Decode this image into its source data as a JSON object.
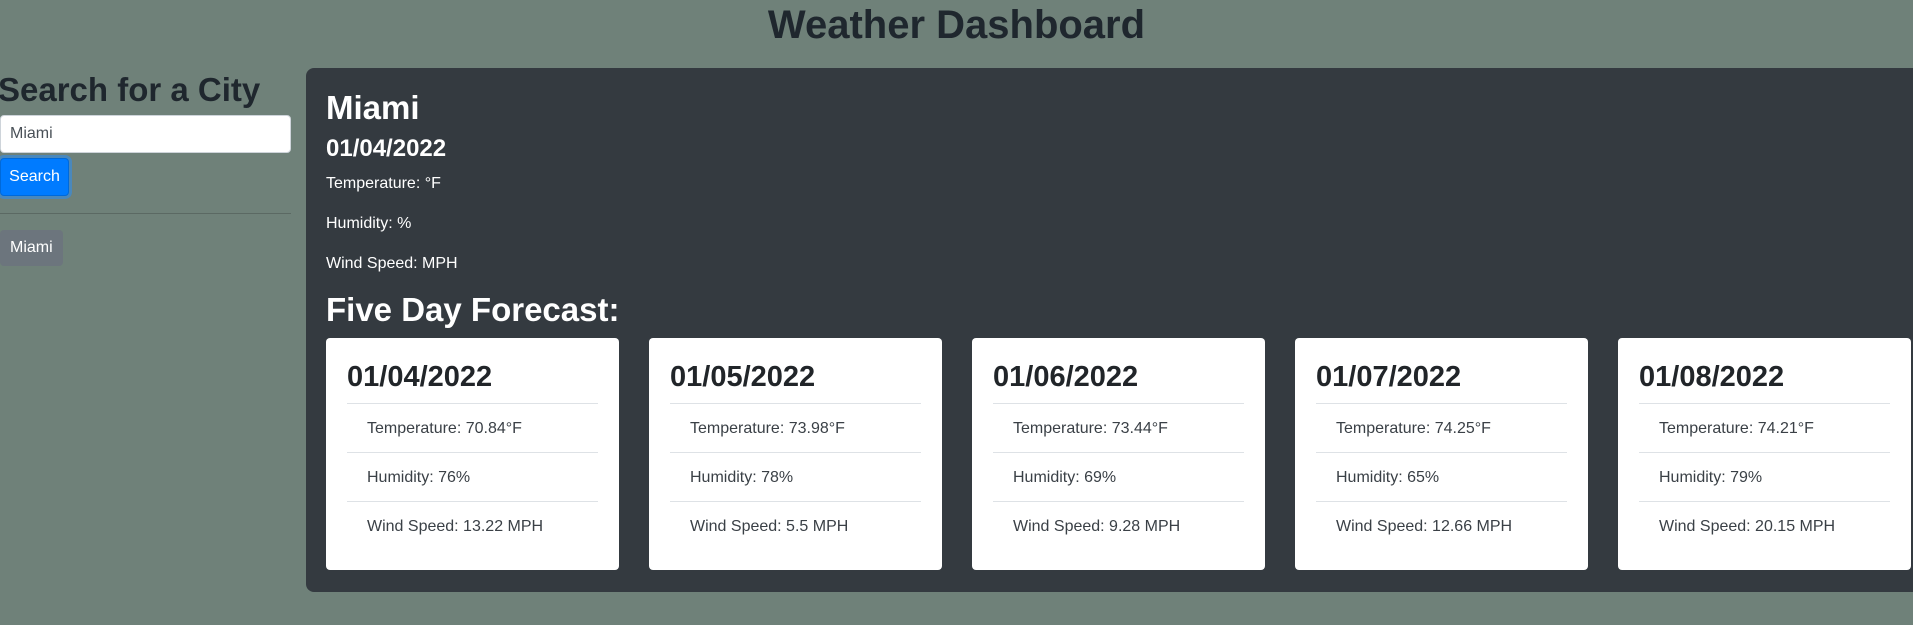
{
  "header": {
    "title": "Weather Dashboard"
  },
  "sidebar": {
    "heading": "Search for a City",
    "search_value": "Miami",
    "search_button": "Search",
    "history": [
      "Miami"
    ]
  },
  "current": {
    "city": "Miami",
    "date": "01/04/2022",
    "temperature": "Temperature: °F",
    "humidity": "Humidity: %",
    "wind": "Wind Speed: MPH"
  },
  "forecast": {
    "heading": "Five Day Forecast:",
    "days": [
      {
        "date": "01/04/2022",
        "temperature": "Temperature: 70.84°F",
        "humidity": "Humidity: 76%",
        "wind": "Wind Speed: 13.22 MPH"
      },
      {
        "date": "01/05/2022",
        "temperature": "Temperature: 73.98°F",
        "humidity": "Humidity: 78%",
        "wind": "Wind Speed: 5.5 MPH"
      },
      {
        "date": "01/06/2022",
        "temperature": "Temperature: 73.44°F",
        "humidity": "Humidity: 69%",
        "wind": "Wind Speed: 9.28 MPH"
      },
      {
        "date": "01/07/2022",
        "temperature": "Temperature: 74.25°F",
        "humidity": "Humidity: 65%",
        "wind": "Wind Speed: 12.66 MPH"
      },
      {
        "date": "01/08/2022",
        "temperature": "Temperature: 74.21°F",
        "humidity": "Humidity: 79%",
        "wind": "Wind Speed: 20.15 MPH"
      }
    ]
  }
}
